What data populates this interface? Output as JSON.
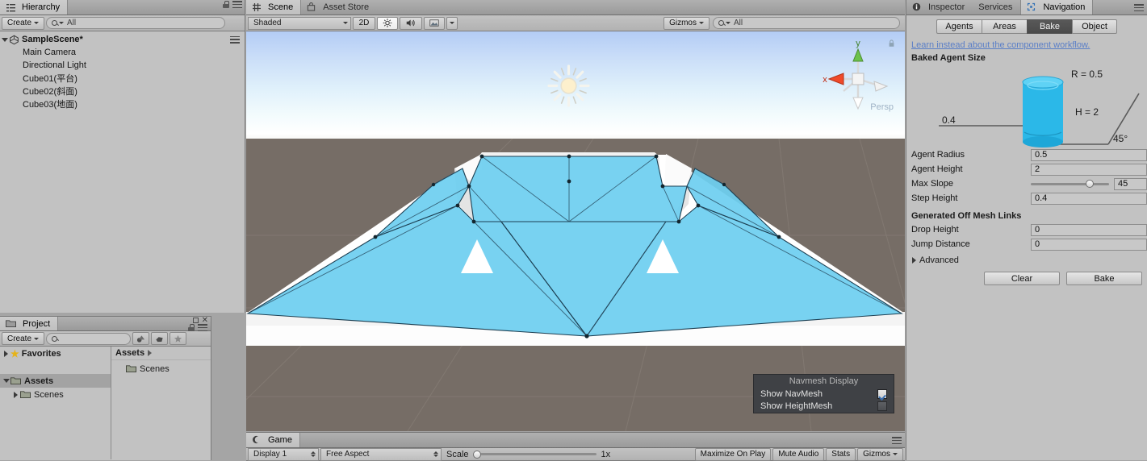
{
  "hierarchy": {
    "tab_label": "Hierarchy",
    "tab_icon": "hierarchy-icon",
    "create_label": "Create",
    "search_placeholder": "All",
    "search_value": "All",
    "scene_name": "SampleScene*",
    "objects": [
      {
        "label": "Main Camera"
      },
      {
        "label": "Directional Light"
      },
      {
        "label": "Cube01(平台)"
      },
      {
        "label": "Cube02(斜面)"
      },
      {
        "label": "Cube03(地面)"
      }
    ]
  },
  "project": {
    "tab_label": "Project",
    "create_label": "Create",
    "search_value": "",
    "favorites_label": "Favorites",
    "assets_label": "Assets",
    "scenes_label": "Scenes",
    "breadcrumb_label": "Assets",
    "content_items": [
      {
        "label": "Scenes"
      }
    ]
  },
  "scene": {
    "tabs": [
      {
        "label": "Scene",
        "icon": "scene-grid-icon",
        "active": true
      },
      {
        "label": "Asset Store",
        "icon": "store-icon",
        "active": false
      }
    ],
    "draw_mode": "Shaded",
    "mode_2d_label": "2D",
    "lighting_icon": "sun-toggle-icon",
    "audio_icon": "speaker-icon",
    "effects_icon": "image-effects-icon",
    "gizmos_label": "Gizmos",
    "search_placeholder": "All",
    "search_value": "All",
    "axis_gizmo": {
      "x_label": "x",
      "y_label": "y",
      "persp_label": "Persp"
    },
    "navmesh_display": {
      "title": "Navmesh Display",
      "options": [
        {
          "label": "Show NavMesh",
          "checked": true
        },
        {
          "label": "Show HeightMesh",
          "checked": false
        }
      ]
    },
    "colors": {
      "navmesh_fill": "#6ecff0",
      "navmesh_edge": "#1d3f52",
      "ground": "#766d66",
      "geometry": "#ffffff",
      "sky_top": "#b3ccf5",
      "sky_horizon": "#ffffff"
    }
  },
  "game": {
    "tab_label": "Game",
    "tab_icon": "game-pad-icon",
    "display_label": "Display 1",
    "aspect_label": "Free Aspect",
    "scale_label": "Scale",
    "scale_value": "1x",
    "scale_percent": 0,
    "maximize_label": "Maximize On Play",
    "mute_label": "Mute Audio",
    "stats_label": "Stats",
    "gizmos_label": "Gizmos"
  },
  "inspector": {
    "tabs": [
      {
        "label": "Inspector",
        "icon": "info-icon",
        "active": false
      },
      {
        "label": "Services",
        "icon": "",
        "active": false
      },
      {
        "label": "Navigation",
        "icon": "navigation-icon",
        "active": true
      }
    ],
    "nav_tabs": [
      {
        "label": "Agents",
        "active": false
      },
      {
        "label": "Areas",
        "active": false
      },
      {
        "label": "Bake",
        "active": true
      },
      {
        "label": "Object",
        "active": false
      }
    ],
    "help_link": "Learn instead about the component workflow.",
    "baked_agent_size_title": "Baked Agent Size",
    "diagram": {
      "radius_label": "R = 0.5",
      "height_label": "H = 2",
      "step_label": "0.4",
      "slope_label": "45°"
    },
    "properties": [
      {
        "label": "Agent Radius",
        "value": "0.5",
        "type": "field"
      },
      {
        "label": "Agent Height",
        "value": "2",
        "type": "field"
      },
      {
        "label": "Max Slope",
        "value": "45",
        "type": "slider",
        "slider_percent": 75
      },
      {
        "label": "Step Height",
        "value": "0.4",
        "type": "field"
      }
    ],
    "offmesh_title": "Generated Off Mesh Links",
    "offmesh_properties": [
      {
        "label": "Drop Height",
        "value": "0",
        "type": "field"
      },
      {
        "label": "Jump Distance",
        "value": "0",
        "type": "field"
      }
    ],
    "advanced_label": "Advanced",
    "clear_label": "Clear",
    "bake_label": "Bake"
  }
}
